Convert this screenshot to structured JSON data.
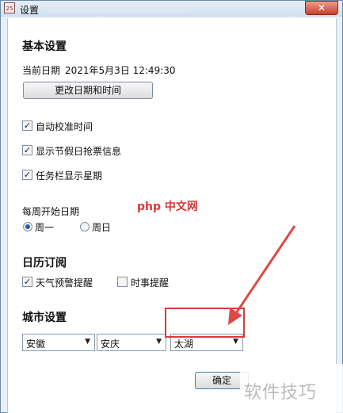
{
  "window": {
    "title": "设置",
    "close": "✕",
    "icon_text": "25"
  },
  "basic": {
    "heading": "基本设置",
    "current_date_label": "当前日期",
    "current_date_value": "2021年5月3日 12:49:30",
    "change_button": "更改日期和时间",
    "auto_sync": {
      "label": "自动校准时间",
      "checked": true
    },
    "holiday_tickets": {
      "label": "显示节假日抢票信息",
      "checked": true
    },
    "taskbar_weekday": {
      "label": "任务栏显示星期",
      "checked": true
    },
    "week_start_label": "每周开始日期",
    "week_options": [
      {
        "label": "周一",
        "selected": true
      },
      {
        "label": "周日",
        "selected": false
      }
    ]
  },
  "calendar_sub": {
    "heading": "日历订阅",
    "weather_alert": {
      "label": "天气预警提醒",
      "checked": true
    },
    "news_alert": {
      "label": "时事提醒",
      "checked": false
    }
  },
  "city": {
    "heading": "城市设置",
    "province": "安徽",
    "city": "安庆",
    "district": "太湖"
  },
  "footer": {
    "ok_button": "确定"
  },
  "watermarks": {
    "php": "php 中文网",
    "site": "软件技巧"
  },
  "colors": {
    "highlight": "#d43c3c",
    "arrow": "#e04848",
    "radio_dot": "#1f5fa8"
  }
}
